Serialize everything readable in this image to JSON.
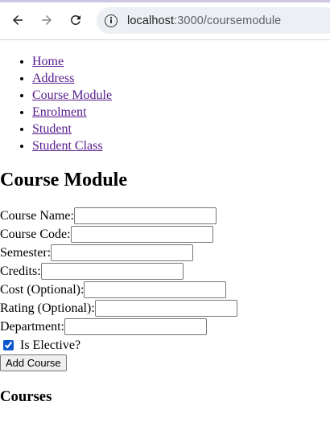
{
  "browser": {
    "url_host": "localhost",
    "url_path": ":3000/coursemodule"
  },
  "nav": {
    "links": [
      "Home",
      "Address",
      "Course Module",
      "Enrolment",
      "Student",
      "Student Class"
    ]
  },
  "main": {
    "heading": "Course Module",
    "fields": [
      {
        "label": "Course Name:",
        "value": ""
      },
      {
        "label": "Course Code:",
        "value": ""
      },
      {
        "label": "Semester:",
        "value": ""
      },
      {
        "label": "Credits:",
        "value": ""
      },
      {
        "label": "Cost (Optional):",
        "value": ""
      },
      {
        "label": "Rating (Optional):",
        "value": ""
      },
      {
        "label": "Department:",
        "value": ""
      }
    ],
    "elective_label": "Is Elective?",
    "elective_checked": true,
    "add_button": "Add Course",
    "courses_heading": "Courses"
  }
}
